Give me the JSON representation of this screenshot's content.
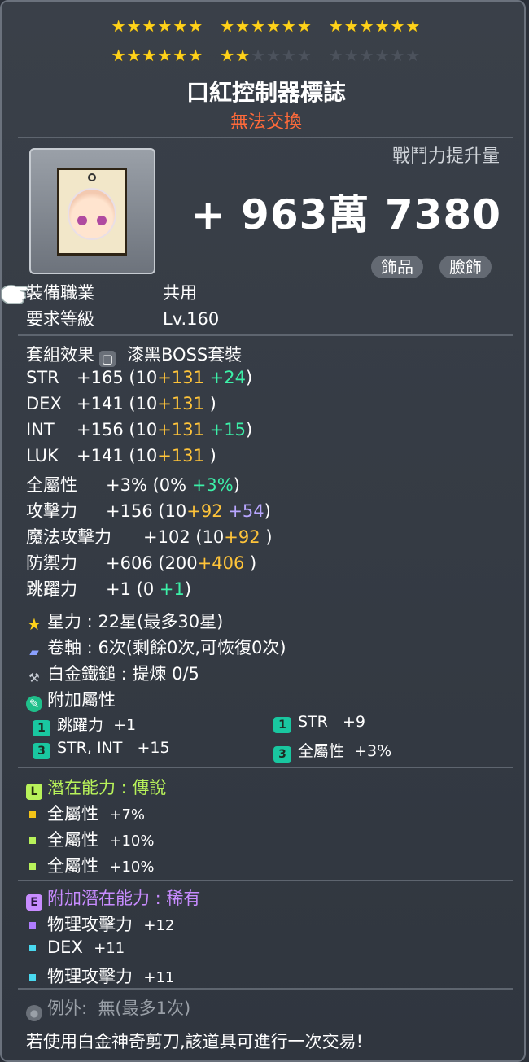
{
  "stars": {
    "row1": "★★★★★★  ★★★★★★  ★★★★★★",
    "filled_total": 22,
    "max_total": 30
  },
  "item": {
    "name": "口紅控制器標誌",
    "trade": "無法交換"
  },
  "combat_boost": {
    "label": "戰鬥力提升量",
    "value": "+ 963萬 7380"
  },
  "tags": [
    "飾品",
    "臉飾"
  ],
  "requirements": [
    {
      "key": "裝備職業",
      "value": "共用"
    },
    {
      "key": "要求等級",
      "value": "Lv.160"
    }
  ],
  "set": {
    "label": "套組效果",
    "value": "漆黑BOSS套裝"
  },
  "stats": [
    {
      "name": "STR",
      "total": "+165",
      "base": "(10",
      "scroll": "+131",
      "extra": "+24",
      "extra_color": "green",
      "close": ")"
    },
    {
      "name": "DEX",
      "total": "+141",
      "base": "(10",
      "scroll": "+131",
      "extra": "",
      "extra_color": "",
      "close": ")"
    },
    {
      "name": "INT",
      "total": "+156",
      "base": "(10",
      "scroll": "+131",
      "extra": "+15",
      "extra_color": "green",
      "close": ")"
    },
    {
      "name": "LUK",
      "total": "+141",
      "base": "(10",
      "scroll": "+131",
      "extra": "",
      "extra_color": "",
      "close": ")"
    },
    {
      "name": "全屬性",
      "total": "+3%",
      "base": "(0%",
      "scroll": "",
      "extra": "+3%",
      "extra_color": "green",
      "close": ")"
    },
    {
      "name": "攻擊力",
      "total": "+156",
      "base": "(10",
      "scroll": "+92",
      "extra": "+54",
      "extra_color": "purple",
      "close": ")"
    },
    {
      "name": "魔法攻擊力",
      "total": "+102",
      "base": "(10",
      "scroll": "+92",
      "extra": "",
      "extra_color": "",
      "close": ")"
    },
    {
      "name": "防禦力",
      "total": "+606",
      "base": "(200",
      "scroll": "+406",
      "extra": "",
      "extra_color": "",
      "close": ")"
    },
    {
      "name": "跳躍力",
      "total": "+1",
      "base": "(0",
      "scroll": "",
      "extra": "+1",
      "extra_color": "green",
      "close": ")"
    }
  ],
  "star_force": {
    "label": "星力",
    "value": "22星(最多30星)"
  },
  "scroll": {
    "label": "卷軸",
    "value": "6次(剩餘0次,可恢復0次)"
  },
  "hammer": {
    "label": "白金鐵鎚",
    "value": "提煉 0/5"
  },
  "bonus": {
    "label": "附加屬性",
    "items": [
      {
        "tier": "1",
        "name": "跳躍力",
        "value": "+1"
      },
      {
        "tier": "1",
        "name": "STR",
        "value": "+9"
      },
      {
        "tier": "3",
        "name": "STR, INT",
        "value": "+15"
      },
      {
        "tier": "3",
        "name": "全屬性",
        "value": "+3%"
      }
    ]
  },
  "potential": {
    "grade_letter": "L",
    "label": "潛在能力 : 傳說",
    "lines": [
      {
        "name": "全屬性",
        "value": "+7%",
        "color": "#f2c318"
      },
      {
        "name": "全屬性",
        "value": "+10%",
        "color": "#b8f25a"
      },
      {
        "name": "全屬性",
        "value": "+10%",
        "color": "#b8f25a"
      }
    ]
  },
  "additional_potential": {
    "grade_letter": "E",
    "label": "附加潛在能力 : 稀有",
    "lines": [
      {
        "name": "物理攻擊力",
        "value": "+12",
        "color": "#b07cff"
      },
      {
        "name": "DEX",
        "value": "+11",
        "color": "#49d9f0"
      },
      {
        "name": "物理攻擊力",
        "value": "+11",
        "color": "#49d9f0"
      }
    ]
  },
  "exception": {
    "label": "例外:",
    "value": "無(最多1次)"
  },
  "footer": "若使用白金神奇剪刀,該道具可進行一次交易!",
  "colors": {
    "accent_gold": "#ffc43a",
    "green": "#3cf0a8",
    "purple": "#b8a6ff",
    "legendary": "#b8f25a",
    "epic": "#c88cff",
    "untradable": "#ff6a3a"
  }
}
